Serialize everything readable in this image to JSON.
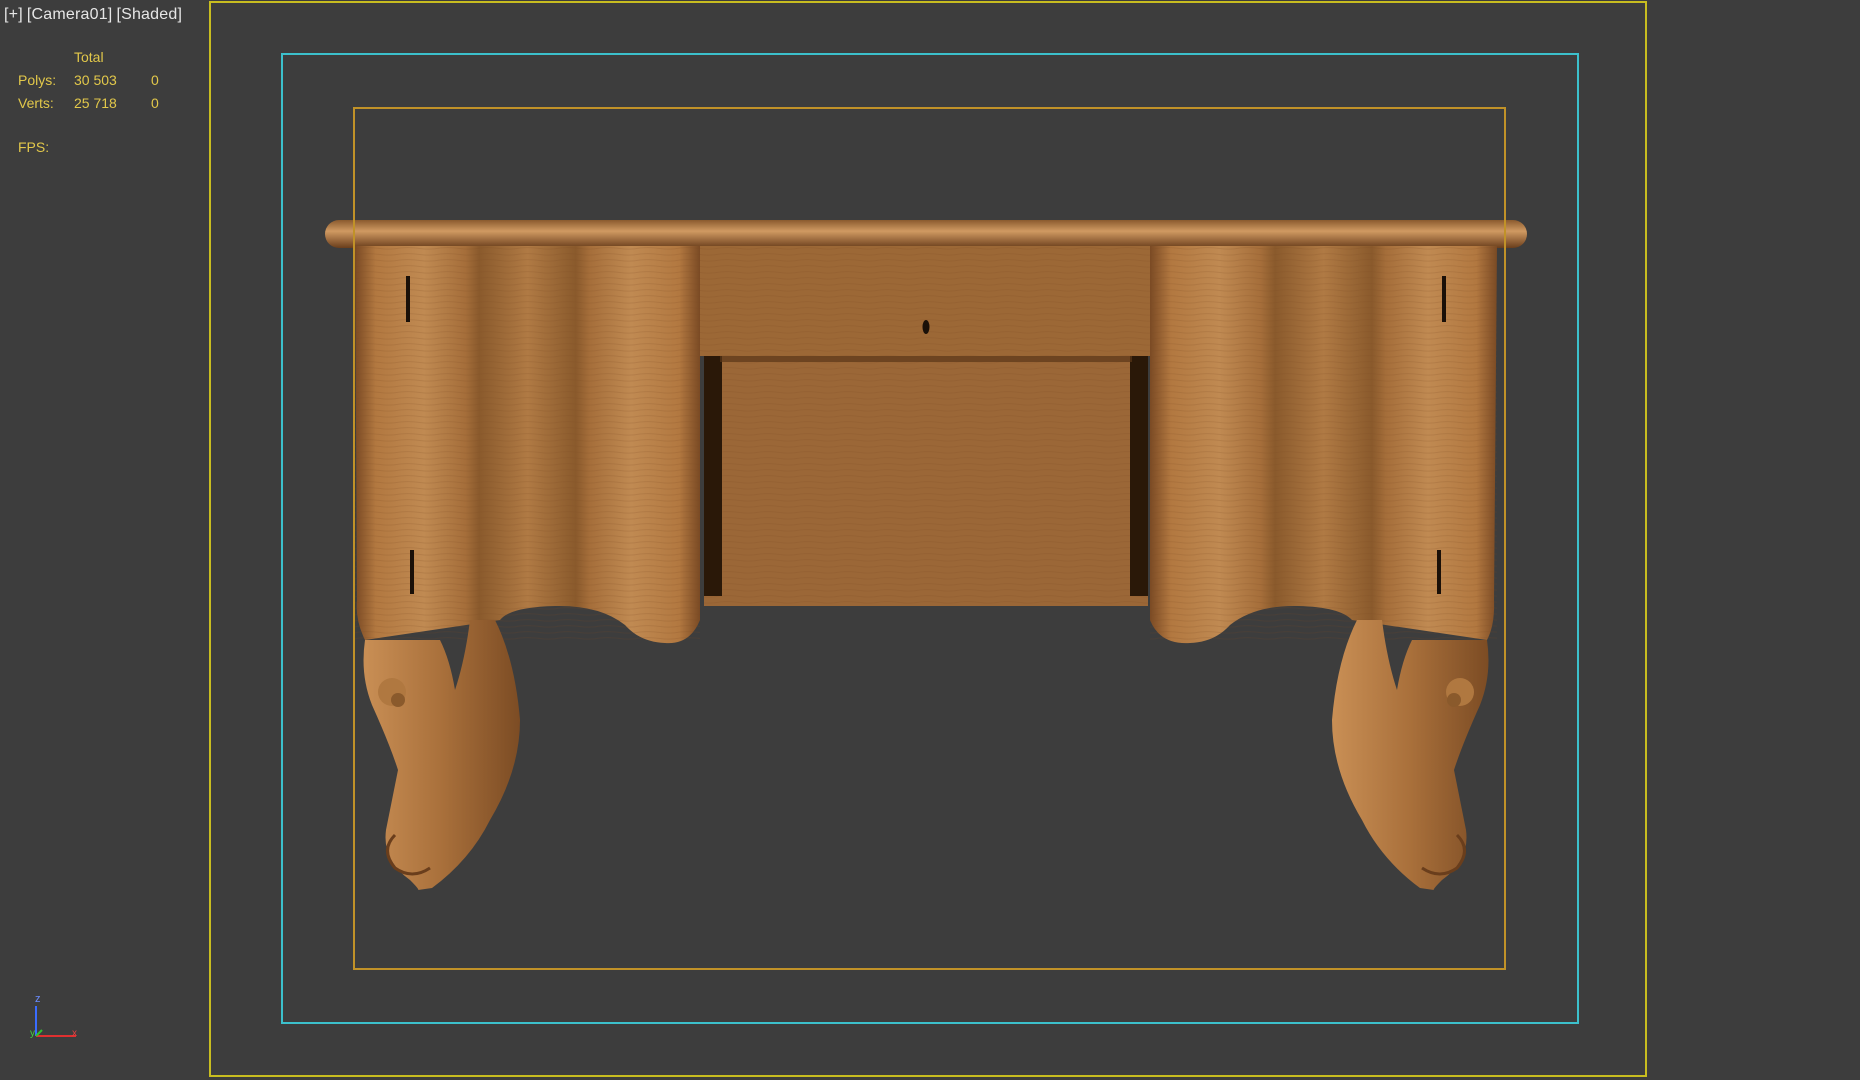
{
  "viewport": {
    "label_plus": "[+]",
    "label_camera": "[Camera01]",
    "label_mode": "[Shaded]"
  },
  "stats": {
    "header": "Total",
    "polys_label": "Polys:",
    "polys_total": "30 503",
    "polys_selected": "0",
    "verts_label": "Verts:",
    "verts_total": "25 718",
    "verts_selected": "0",
    "fps_label": "FPS:"
  },
  "axis_gizmo": {
    "z_label": "z",
    "y_label": "y",
    "x_label": "x"
  },
  "colors": {
    "background": "#3d3d3d",
    "stats_text": "#e2c84a",
    "safe_frame": "#c8bd20",
    "action_safe": "#3cc0cc",
    "title_safe": "#c19228",
    "wood_light": "#b3783f",
    "wood_dark": "#6e4220"
  },
  "scene": {
    "object": "desk-model"
  }
}
